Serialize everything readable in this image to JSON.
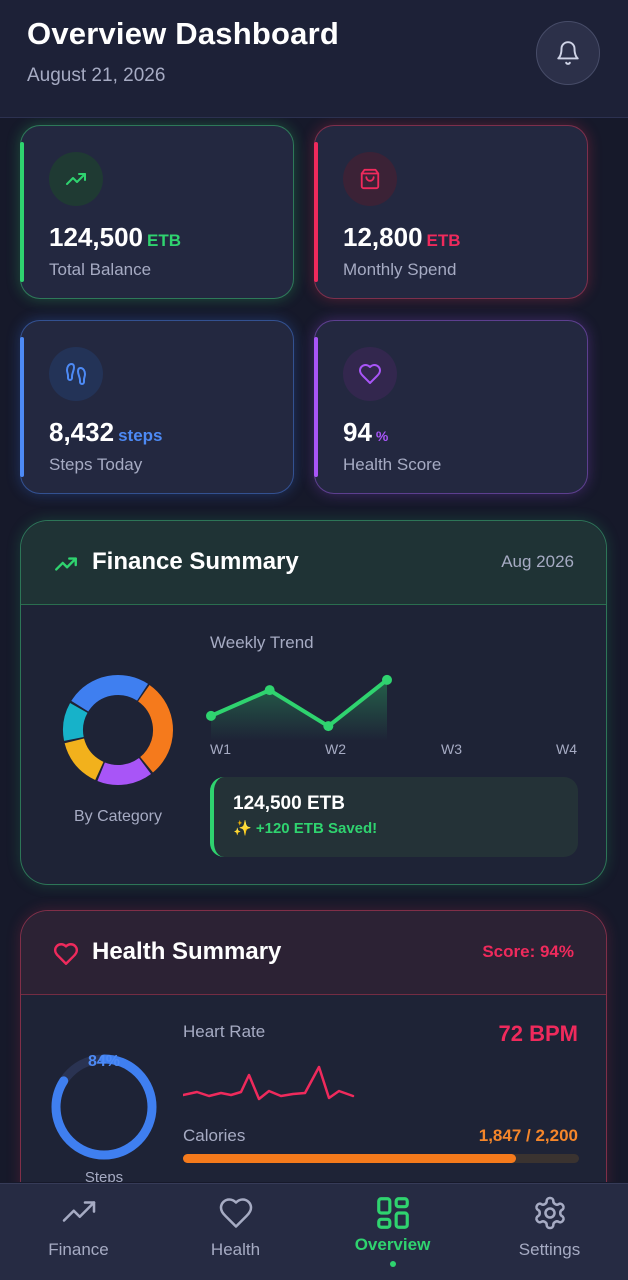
{
  "header": {
    "title": "Overview Dashboard",
    "date": "August 21, 2026"
  },
  "stats": [
    {
      "value": "124,500",
      "unit": "ETB",
      "label": "Total Balance",
      "icon": "trending-up-icon",
      "accent": "#2fd36f"
    },
    {
      "value": "12,800",
      "unit": "ETB",
      "label": "Monthly Spend",
      "icon": "shopping-bag-icon",
      "accent": "#ef2a5c"
    },
    {
      "value": "8,432",
      "unit": "steps",
      "label": "Steps Today",
      "icon": "footprints-icon",
      "accent": "#4d8af5"
    },
    {
      "value": "94",
      "unit": "%",
      "label": "Health Score",
      "icon": "heart-icon",
      "accent": "#a855f7"
    }
  ],
  "finance": {
    "title": "Finance Summary",
    "period": "Aug 2026",
    "category_label": "By Category",
    "trend_label": "Weekly Trend",
    "weeks": [
      "W1",
      "W2",
      "W3",
      "W4"
    ],
    "saved_amount": "124,500 ETB",
    "saved_note": "✨ +120 ETB Saved!",
    "category_chart": {
      "type": "donut",
      "segments": [
        {
          "color": "#f57a1c",
          "value": 30
        },
        {
          "color": "#a855f7",
          "value": 17
        },
        {
          "color": "#f2b11c",
          "value": 15
        },
        {
          "color": "#17b2c9",
          "value": 12
        },
        {
          "color": "#3f7ff0",
          "value": 26
        }
      ]
    },
    "trend_chart": {
      "type": "line",
      "points": [
        {
          "x": 0,
          "y": 20
        },
        {
          "x": 1,
          "y": 50
        },
        {
          "x": 2,
          "y": 8
        },
        {
          "x": 3,
          "y": 62
        }
      ],
      "color": "#2fd36f"
    }
  },
  "health": {
    "title": "Health Summary",
    "score": "Score: 94%",
    "heart_rate_label": "Heart Rate",
    "heart_rate_value": "72 BPM",
    "calories_label": "Calories",
    "calories_value": "1,847 / 2,200",
    "calories_fraction": 0.84,
    "steps_percent": "84%",
    "steps_fraction": 0.84,
    "steps_label": "Steps",
    "heart_wave_color": "#ef2a5c"
  },
  "nav": [
    {
      "label": "Finance",
      "icon": "trending-up-icon",
      "active": false
    },
    {
      "label": "Health",
      "icon": "heart-icon",
      "active": false
    },
    {
      "label": "Overview",
      "icon": "grid-icon",
      "active": true
    },
    {
      "label": "Settings",
      "icon": "gear-icon",
      "active": false
    }
  ]
}
